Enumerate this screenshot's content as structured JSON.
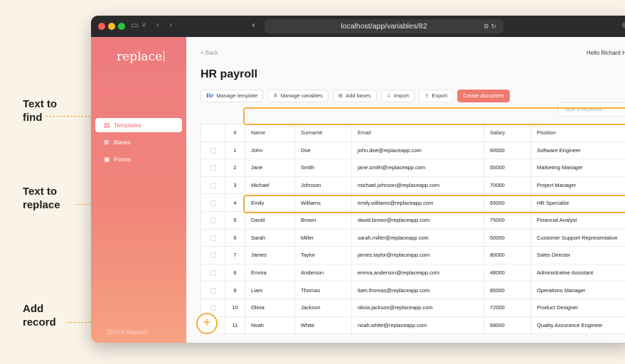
{
  "callouts": {
    "find": [
      "Text to",
      "find"
    ],
    "replace": [
      "Text to",
      "replace"
    ],
    "add": [
      "Add",
      "record"
    ]
  },
  "browser": {
    "url": "localhost/app/variables/82"
  },
  "sidebar": {
    "logo": "replace",
    "items": [
      {
        "label": "Templates",
        "icon": "template-icon",
        "active": true
      },
      {
        "label": "Bases",
        "icon": "grid-icon",
        "active": false
      },
      {
        "label": "Forms",
        "icon": "form-icon",
        "active": false
      }
    ],
    "footer": "2024 © Replace"
  },
  "header": {
    "back": "< Back",
    "greeting": "Hello Richard Her"
  },
  "page": {
    "title": "HR payroll"
  },
  "toolbar": {
    "manage_template": "Manage template",
    "manage_variables": "Manage variables",
    "add_bases": "Add bases",
    "import": "Import",
    "export": "Export",
    "create_document": "Create document",
    "search_placeholder": "Type a keyword..."
  },
  "table": {
    "columns": [
      "",
      "#",
      "Name",
      "Surname",
      "Email",
      "Salary",
      "Position"
    ],
    "rows": [
      [
        "1",
        "John",
        "Doe",
        "john.doe@replaceapp.com",
        "60000",
        "Software Engineer"
      ],
      [
        "2",
        "Jane",
        "Smith",
        "jane.smith@replaceapp.com",
        "55000",
        "Marketing Manager"
      ],
      [
        "3",
        "Michael",
        "Johnson",
        "michael.johnson@replaceapp.com",
        "70000",
        "Project Manager"
      ],
      [
        "4",
        "Emily",
        "Williams",
        "emily.williams@replaceapp.com",
        "65000",
        "HR Specialist"
      ],
      [
        "5",
        "David",
        "Brown",
        "david.brown@replaceapp.com",
        "75000",
        "Financial Analyst"
      ],
      [
        "6",
        "Sarah",
        "Miller",
        "sarah.miller@replaceapp.com",
        "50000",
        "Customer Support Representative"
      ],
      [
        "7",
        "James",
        "Taylor",
        "james.taylor@replaceapp.com",
        "80000",
        "Sales Director"
      ],
      [
        "8",
        "Emma",
        "Anderson",
        "emma.anderson@replaceapp.com",
        "48000",
        "Administrative Assistant"
      ],
      [
        "9",
        "Liam",
        "Thomas",
        "liam.thomas@replaceapp.com",
        "85000",
        "Operations Manager"
      ],
      [
        "10",
        "Olivia",
        "Jackson",
        "olivia.jackson@replaceapp.com",
        "72000",
        "Product Designer"
      ],
      [
        "11",
        "Noah",
        "White",
        "noah.white@replaceapp.com",
        "68000",
        "Quality Assurance Engineer"
      ]
    ]
  },
  "add_button": "+",
  "colors": {
    "accent": "#f5b03a",
    "brand": "#ef7a70"
  }
}
